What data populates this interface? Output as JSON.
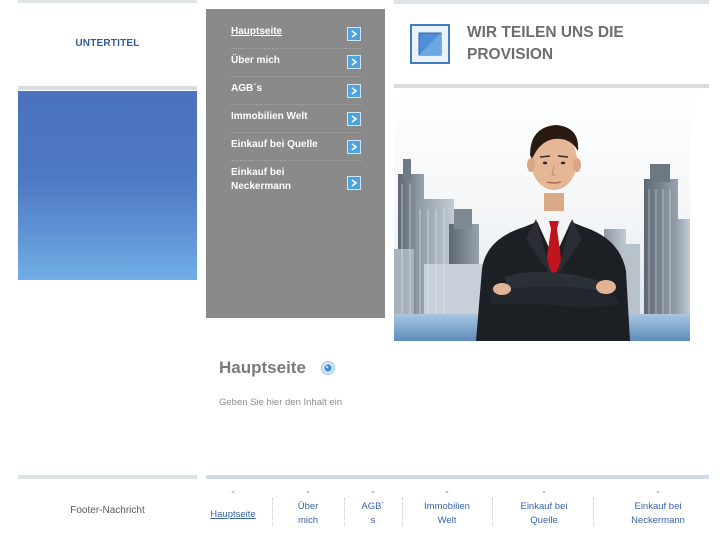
{
  "subtitle": "UNTERTITEL",
  "site_title": "WIR TEILEN UNS DIE PROVISION",
  "nav": {
    "items": [
      {
        "label": "Hauptseite",
        "active": true
      },
      {
        "label": "Über mich"
      },
      {
        "label": "AGB´s"
      },
      {
        "label": "Immobilien Welt"
      },
      {
        "label": "Einkauf bei Quelle"
      },
      {
        "label": "Einkauf bei Neckermann"
      }
    ]
  },
  "content": {
    "title": "Hauptseite",
    "text": "Geben Sie hier den Inhalt ein"
  },
  "footer": {
    "message": "Footer-Nachricht",
    "nav": [
      {
        "chevron": "ˇ",
        "line1": "Hauptseite",
        "line2": ""
      },
      {
        "chevron": "ˇ",
        "line1": "Über",
        "line2": "mich"
      },
      {
        "chevron": "ˇ",
        "line1": "AGB´",
        "line2": "s"
      },
      {
        "chevron": "ˇ",
        "line1": "Immobilien",
        "line2": "Welt"
      },
      {
        "chevron": "ˇ",
        "line1": "Einkauf bei",
        "line2": "Quelle"
      },
      {
        "chevron": "ˇ",
        "line1": "Einkauf bei",
        "line2": "Neckermann"
      }
    ]
  },
  "colors": {
    "nav_bg": "#8a8a8a",
    "accent_blue": "#4fa3dd",
    "subtitle": "#2f5b9a",
    "link": "#3a64a8"
  },
  "icons": {
    "nav_arrow": "arrow-right-icon",
    "logo": "square-logo-icon",
    "title_bullet": "blue-dot-icon"
  }
}
